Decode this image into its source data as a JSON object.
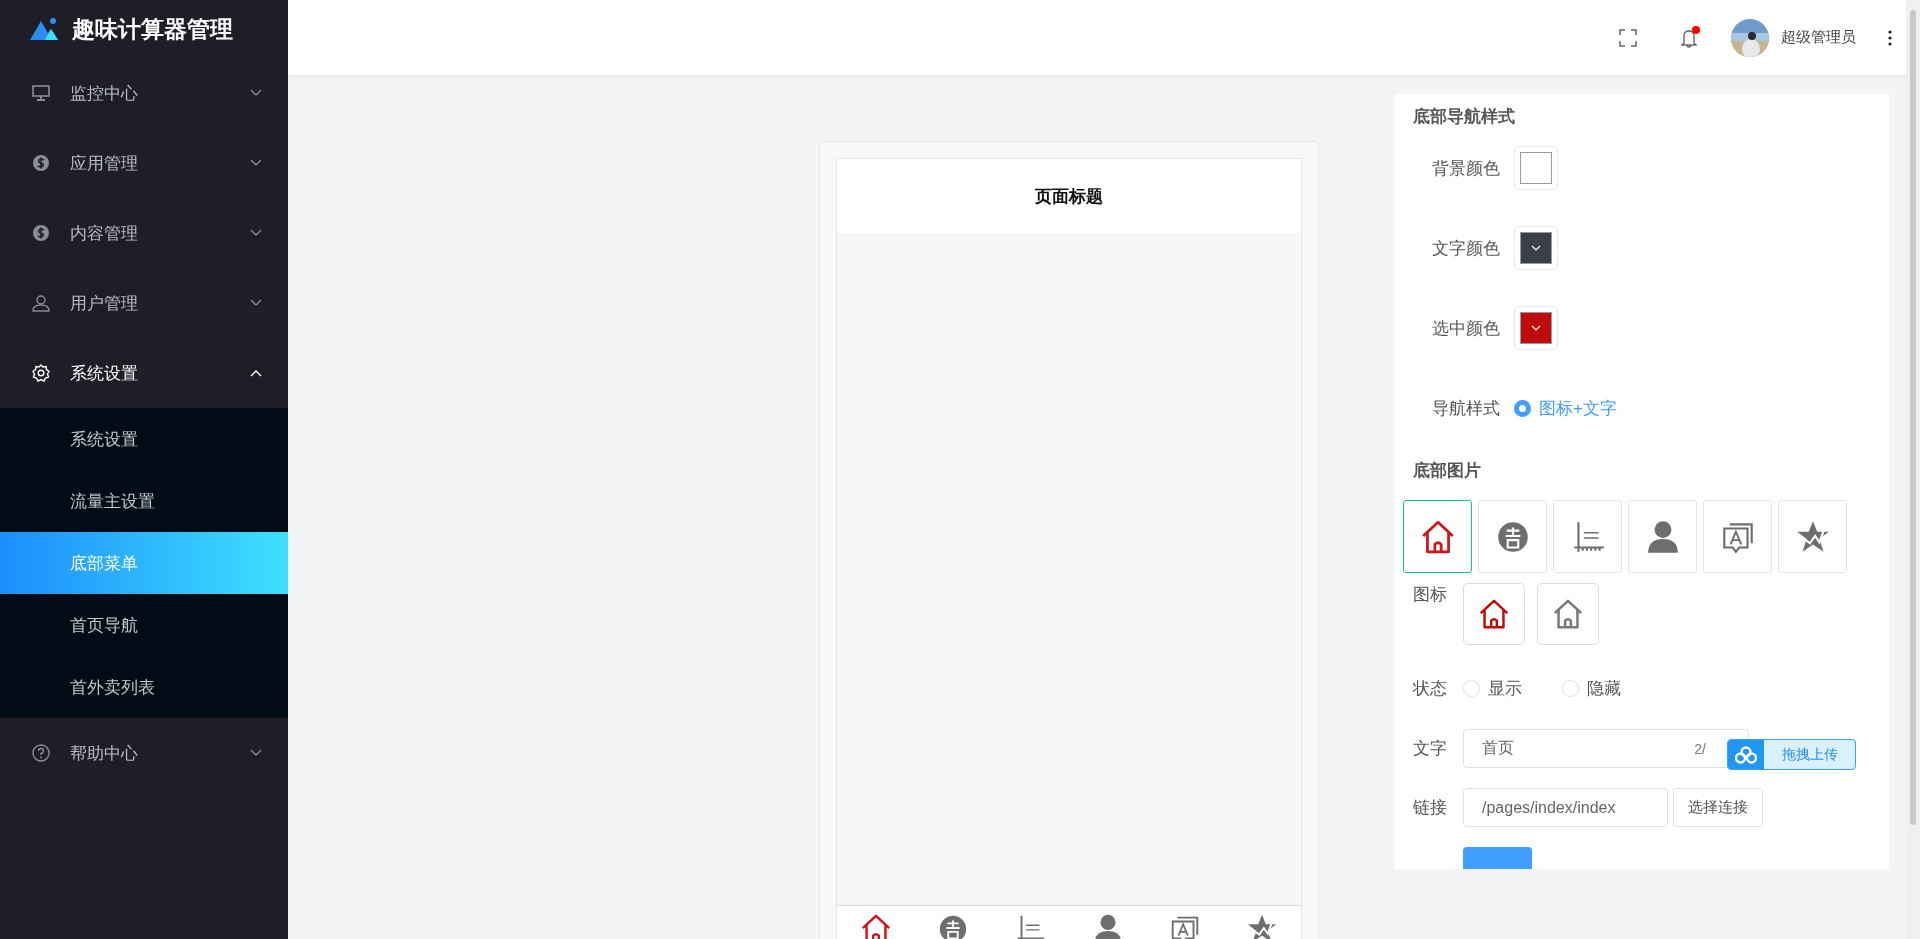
{
  "app": {
    "title": "趣味计算器管理"
  },
  "sidebar": {
    "items": [
      {
        "label": "监控中心",
        "kind": "monitor",
        "expanded": false
      },
      {
        "label": "应用管理",
        "kind": "coin",
        "expanded": false
      },
      {
        "label": "内容管理",
        "kind": "coin",
        "expanded": false
      },
      {
        "label": "用户管理",
        "kind": "user",
        "expanded": false
      },
      {
        "label": "系统设置",
        "kind": "gear",
        "expanded": true,
        "children": [
          {
            "label": "系统设置",
            "selected": false
          },
          {
            "label": "流量主设置",
            "selected": false
          },
          {
            "label": "底部菜单",
            "selected": true
          },
          {
            "label": "首页导航",
            "selected": false
          },
          {
            "label": "首外卖列表",
            "selected": false
          }
        ]
      },
      {
        "label": "帮助中心",
        "kind": "help",
        "expanded": false
      }
    ]
  },
  "header": {
    "notification": true,
    "user": {
      "name": "超级管理员"
    }
  },
  "preview": {
    "title": "页面标题",
    "nav_items": [
      {
        "kind": "home",
        "selected": true
      },
      {
        "kind": "badge",
        "selected": false
      },
      {
        "kind": "ruler",
        "selected": false
      },
      {
        "kind": "person",
        "selected": false
      },
      {
        "kind": "message",
        "selected": false
      },
      {
        "kind": "star",
        "selected": false
      }
    ]
  },
  "settings": {
    "nav_style_title": "底部导航样式",
    "colors": [
      {
        "label": "背景颜色",
        "color": "#ffffff"
      },
      {
        "label": "文字颜色",
        "color": "#3c3f4b"
      },
      {
        "label": "选中颜色",
        "color": "#c00a0a"
      }
    ],
    "nav_style": {
      "label": "导航样式",
      "options": [
        {
          "label": "图标+文字",
          "selected": true
        }
      ]
    },
    "images_title": "底部图片",
    "images": [
      {
        "kind": "home",
        "selected": true
      },
      {
        "kind": "badge",
        "selected": false
      },
      {
        "kind": "ruler",
        "selected": false
      },
      {
        "kind": "person",
        "selected": false
      },
      {
        "kind": "message",
        "selected": false
      },
      {
        "kind": "star",
        "selected": false
      }
    ],
    "icon_field": {
      "label": "图标",
      "icons": [
        {
          "kind": "home",
          "color": "#c00a0a"
        },
        {
          "kind": "home",
          "color": "#777777"
        }
      ]
    },
    "status": {
      "label": "状态",
      "options": [
        {
          "label": "显示",
          "selected": false
        },
        {
          "label": "隐藏",
          "selected": false
        }
      ]
    },
    "text_field": {
      "label": "文字",
      "value": "首页",
      "counter": "2/"
    },
    "link_field": {
      "label": "链接",
      "value": "/pages/index/index",
      "button": "选择连接"
    }
  },
  "upload_widget": {
    "label": "拖拽上传"
  }
}
